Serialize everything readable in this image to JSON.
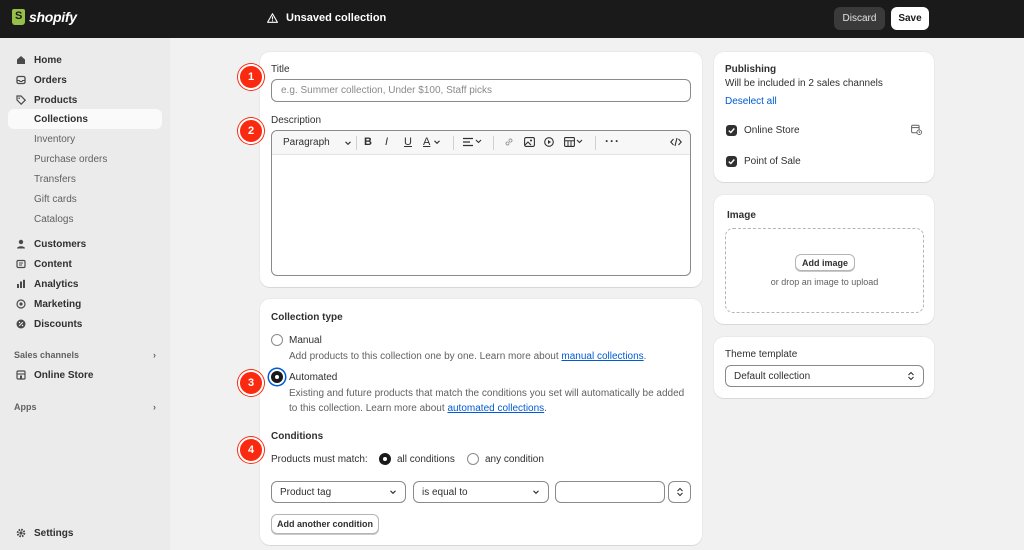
{
  "topbar": {
    "logo_text": "shopify",
    "status_title": "Unsaved collection",
    "discard_label": "Discard",
    "save_label": "Save"
  },
  "sidebar": {
    "items": [
      {
        "label": "Home",
        "icon": "home-icon"
      },
      {
        "label": "Orders",
        "icon": "inbox-icon"
      },
      {
        "label": "Products",
        "icon": "tag-icon"
      },
      {
        "label": "Collections",
        "icon": ""
      },
      {
        "label": "Inventory"
      },
      {
        "label": "Purchase orders"
      },
      {
        "label": "Transfers"
      },
      {
        "label": "Gift cards"
      },
      {
        "label": "Catalogs"
      },
      {
        "label": "Customers",
        "icon": "person-icon"
      },
      {
        "label": "Content",
        "icon": "content-icon"
      },
      {
        "label": "Analytics",
        "icon": "bar-chart-icon"
      },
      {
        "label": "Marketing",
        "icon": "target-icon"
      },
      {
        "label": "Discounts",
        "icon": "discount-icon"
      }
    ],
    "sales_channels_label": "Sales channels",
    "online_store_label": "Online Store",
    "apps_label": "Apps",
    "settings_label": "Settings"
  },
  "title_card": {
    "title_label": "Title",
    "title_placeholder": "e.g. Summer collection, Under $100, Staff picks",
    "description_label": "Description",
    "paragraph_label": "Paragraph"
  },
  "collection_type": {
    "heading": "Collection type",
    "manual_label": "Manual",
    "manual_desc": "Add products to this collection one by one. Learn more about ",
    "manual_link": "manual collections",
    "automated_label": "Automated",
    "automated_desc_1": "Existing and future products that match the conditions you set will automatically be added",
    "automated_desc_2": "to this collection. Learn more about ",
    "automated_link": "automated collections",
    "conditions_heading": "Conditions",
    "must_match_label": "Products must match:",
    "all_conditions": "all conditions",
    "any_condition": "any condition",
    "field_value": "Product tag",
    "operator_value": "is equal to",
    "add_condition_label": "Add another condition"
  },
  "publishing": {
    "heading": "Publishing",
    "subtitle": "Will be included in 2 sales channels",
    "deselect_label": "Deselect all",
    "channels": [
      "Online Store",
      "Point of Sale"
    ]
  },
  "image_card": {
    "heading": "Image",
    "add_image_label": "Add image",
    "drop_hint": "or drop an image to upload"
  },
  "theme": {
    "heading": "Theme template",
    "selected": "Default collection"
  },
  "badges": [
    "1",
    "2",
    "3",
    "4"
  ],
  "colors": {
    "badge": "#fa2a10",
    "topbar": "#1a1a1a",
    "link": "#005bd3"
  }
}
